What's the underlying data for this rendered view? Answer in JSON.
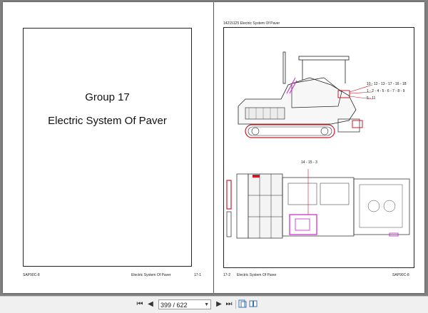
{
  "left_page": {
    "group_title": "Group 17",
    "subtitle": "Electric System Of Paver",
    "footer_left": "SAP90C-8",
    "footer_center": "Electric System Of Paver",
    "footer_right": "17-1"
  },
  "right_page": {
    "header": "14215125   Electric System Of Paver",
    "callouts": {
      "c1": "10 - 12 - 13 - 17 - 16  - 18",
      "c2": "1 - 2 - 4 - 5 - 6 - 7 - 8 - 9",
      "c3": "5 - 11",
      "c4": "14 - 15 - 3"
    },
    "footer_left": "17-2",
    "footer_center": "Electric System Of Paver",
    "footer_right": "SAP90C-8"
  },
  "toolbar": {
    "page_indicator": "399 / 622",
    "icons": [
      "first-page-icon",
      "previous-page-icon",
      "next-page-icon",
      "last-page-icon",
      "single-page-view-icon",
      "two-page-view-icon"
    ]
  },
  "colors": {
    "accent_red": "#cc1a2a",
    "accent_magenta": "#cc22cc"
  }
}
